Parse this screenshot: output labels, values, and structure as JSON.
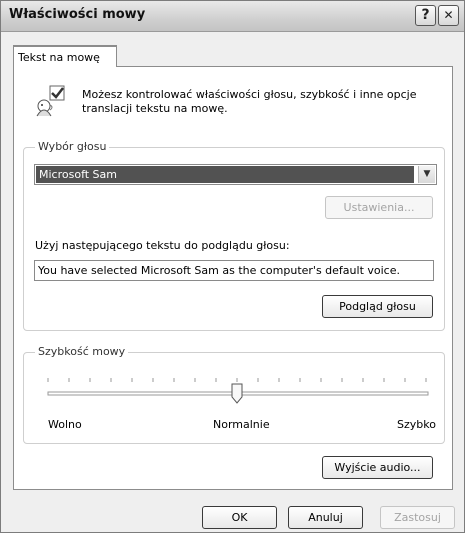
{
  "window": {
    "title": "Właściwości mowy",
    "help_label": "?",
    "close_label": "✕"
  },
  "tabs": [
    {
      "label": "Tekst na mowę"
    }
  ],
  "intro": {
    "line1": "Możesz kontrolować właściwości głosu, szybkość i inne opcje",
    "line2": "translacji tekstu na mowę."
  },
  "voice_group": {
    "legend": "Wybór głosu",
    "selected_voice": "Microsoft Sam",
    "settings_button": "Ustawienia...",
    "preview_label": "Użyj następującego tekstu do podglądu głosu:",
    "preview_text": "You have selected Microsoft Sam as the computer's default voice.",
    "preview_button": "Podgląd głosu"
  },
  "speed_group": {
    "legend": "Szybkość mowy",
    "slow_label": "Wolno",
    "normal_label": "Normalnie",
    "fast_label": "Szybko",
    "slider_value": 0.5
  },
  "audio_output_button": "Wyjście audio...",
  "footer": {
    "ok": "OK",
    "cancel": "Anuluj",
    "apply": "Zastosuj"
  },
  "icons": {
    "speech": "speech-properties-icon",
    "help": "help-icon",
    "close": "close-icon",
    "dropdown": "chevron-down-icon"
  }
}
